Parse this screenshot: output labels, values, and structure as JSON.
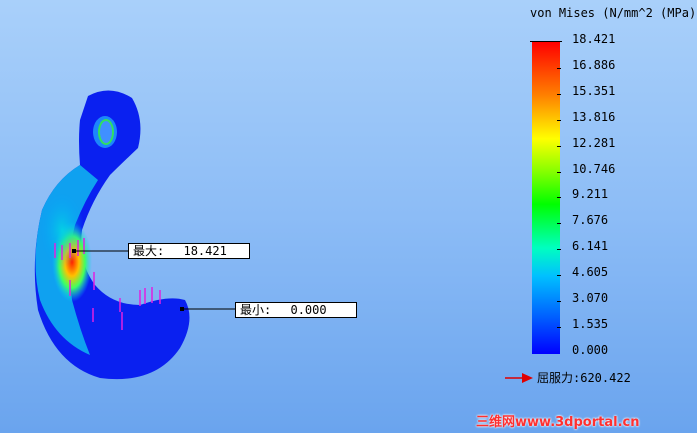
{
  "legend": {
    "title": "von Mises (N/mm^2 (MPa))",
    "values": [
      "18.421",
      "16.886",
      "15.351",
      "13.816",
      "12.281",
      "10.746",
      "9.211",
      "7.676",
      "6.141",
      "4.605",
      "3.070",
      "1.535",
      "0.000"
    ],
    "yield_label": "屈服力:",
    "yield_value": "620.422",
    "colors": {
      "max": "#ff0000",
      "min": "#0000ff"
    }
  },
  "annotations": {
    "max_label": "最大:",
    "max_value": "18.421",
    "min_label": "最小:",
    "min_value": "0.000"
  },
  "watermark": "三维网www.3dportal.cn"
}
